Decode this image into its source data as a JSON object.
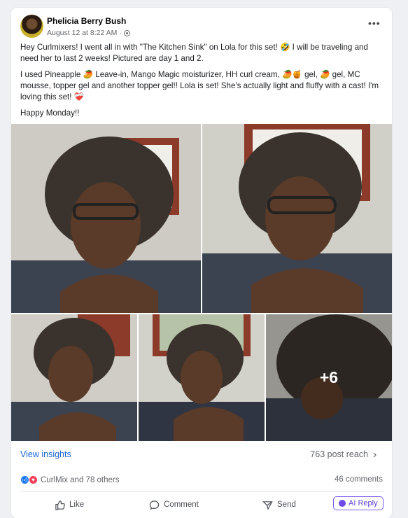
{
  "post": {
    "author": "Phelicia Berry Bush",
    "timestamp": "August 12 at 8:22 AM",
    "visibility_separator": "·",
    "more_label": "•••",
    "paragraphs": [
      "Hey Curlmixers! I went all in with \"The Kitchen Sink\" on Lola for this set! 🤣 I will be traveling and need her to last 2 weeks! Pictured are day 1 and 2.",
      "I used Pineapple 🥭 Leave-in,  Mango Magic moisturizer,  HH curl cream, 🥭🍯 gel, 🥭 gel,  MC mousse, topper gel and another topper gel!! Lola is set! She's actually light and fluffy with a cast! I'm loving this set! ❤️‍🩹",
      "Happy Monday!!"
    ],
    "more_photos_label": "+6"
  },
  "stats": {
    "insights_label": "View insights",
    "reach_label": "763 post reach",
    "reactions_label": "CurlMix and 78 others",
    "comments_label": "46 comments"
  },
  "actions": {
    "like": "Like",
    "comment": "Comment",
    "send": "Send",
    "ai_reply": "AI Reply"
  },
  "icons": [
    "more-options-icon",
    "globe-icon",
    "chevron-right-icon",
    "like-reaction-icon",
    "love-reaction-icon",
    "thumbs-up-icon",
    "comment-bubble-icon",
    "send-icon",
    "ai-sparkle-icon"
  ],
  "colors": {
    "link": "#1a66d6",
    "ai_accent": "#6e4be6",
    "like_blue": "#1877f2",
    "love_red": "#f33e58"
  }
}
